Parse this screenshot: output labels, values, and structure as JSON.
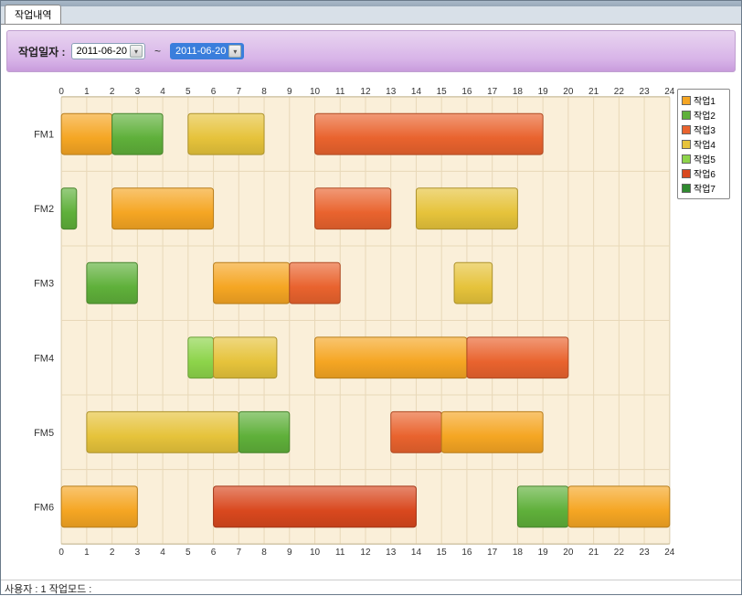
{
  "tab": {
    "label": "작업내역"
  },
  "filter": {
    "date_label": "작업일자 :",
    "from": "2011-06-20",
    "sep": "~",
    "to": "2011-06-20"
  },
  "status": {
    "user_label": "사용자 : ",
    "user_value": "1 ",
    "mode_label": "작업모드 :"
  },
  "legend": [
    {
      "name": "작업1",
      "color": "#f5a623"
    },
    {
      "name": "작업2",
      "color": "#5fb03a"
    },
    {
      "name": "작업3",
      "color": "#e9632e"
    },
    {
      "name": "작업4",
      "color": "#e6c33b"
    },
    {
      "name": "작업5",
      "color": "#8dd44a"
    },
    {
      "name": "작업6",
      "color": "#d9481e"
    },
    {
      "name": "작업7",
      "color": "#2f8a2f"
    }
  ],
  "chart_data": {
    "type": "gantt",
    "xlim": [
      0,
      24
    ],
    "x_ticks": [
      0,
      1,
      2,
      3,
      4,
      5,
      6,
      7,
      8,
      9,
      10,
      11,
      12,
      13,
      14,
      15,
      16,
      17,
      18,
      19,
      20,
      21,
      22,
      23,
      24
    ],
    "categories": [
      "FM1",
      "FM2",
      "FM3",
      "FM4",
      "FM5",
      "FM6"
    ],
    "plot_bg": "#faefd9",
    "grid_color": "#e8d8b8",
    "bars": [
      {
        "row": "FM1",
        "start": 0,
        "end": 2,
        "series": "작업1"
      },
      {
        "row": "FM1",
        "start": 2,
        "end": 4,
        "series": "작업2"
      },
      {
        "row": "FM1",
        "start": 5,
        "end": 8,
        "series": "작업4"
      },
      {
        "row": "FM1",
        "start": 10,
        "end": 19,
        "series": "작업3"
      },
      {
        "row": "FM2",
        "start": 0,
        "end": 0.6,
        "series": "작업2"
      },
      {
        "row": "FM2",
        "start": 2,
        "end": 6,
        "series": "작업1"
      },
      {
        "row": "FM2",
        "start": 10,
        "end": 13,
        "series": "작업3"
      },
      {
        "row": "FM2",
        "start": 14,
        "end": 18,
        "series": "작업4"
      },
      {
        "row": "FM3",
        "start": 1,
        "end": 3,
        "series": "작업2"
      },
      {
        "row": "FM3",
        "start": 6,
        "end": 9,
        "series": "작업1"
      },
      {
        "row": "FM3",
        "start": 9,
        "end": 11,
        "series": "작업3"
      },
      {
        "row": "FM3",
        "start": 15.5,
        "end": 17,
        "series": "작업4"
      },
      {
        "row": "FM4",
        "start": 5,
        "end": 6,
        "series": "작업5"
      },
      {
        "row": "FM4",
        "start": 6,
        "end": 8.5,
        "series": "작업4"
      },
      {
        "row": "FM4",
        "start": 10,
        "end": 16,
        "series": "작업1"
      },
      {
        "row": "FM4",
        "start": 16,
        "end": 20,
        "series": "작업3"
      },
      {
        "row": "FM5",
        "start": 1,
        "end": 7,
        "series": "작업4"
      },
      {
        "row": "FM5",
        "start": 7,
        "end": 9,
        "series": "작업2"
      },
      {
        "row": "FM5",
        "start": 13,
        "end": 15,
        "series": "작업3"
      },
      {
        "row": "FM5",
        "start": 15,
        "end": 19,
        "series": "작업1"
      },
      {
        "row": "FM6",
        "start": 0,
        "end": 3,
        "series": "작업1"
      },
      {
        "row": "FM6",
        "start": 6,
        "end": 14,
        "series": "작업6"
      },
      {
        "row": "FM6",
        "start": 18,
        "end": 20,
        "series": "작업2"
      },
      {
        "row": "FM6",
        "start": 20,
        "end": 24,
        "series": "작업1"
      }
    ]
  }
}
